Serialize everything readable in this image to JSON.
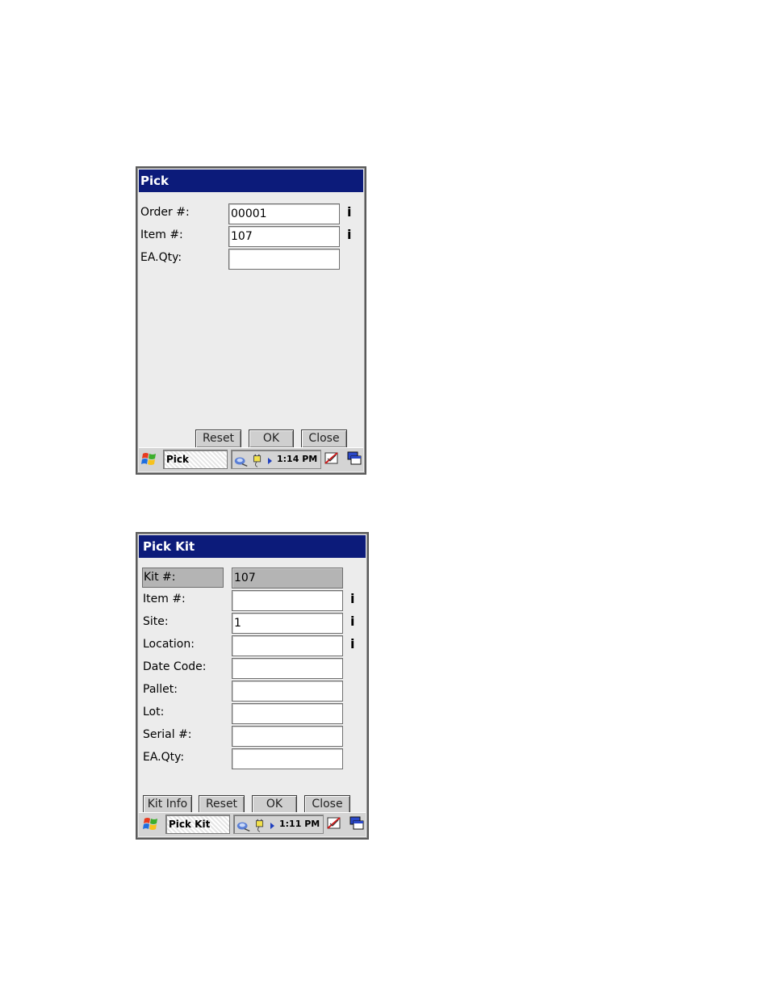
{
  "pick": {
    "title": "Pick",
    "rows": [
      {
        "label": "Order #:",
        "value": "00001",
        "info": "i"
      },
      {
        "label": "Item #:",
        "value": "107",
        "info": "i"
      },
      {
        "label": "EA.Qty:",
        "value": "",
        "info": ""
      }
    ],
    "buttons": {
      "reset": "Reset",
      "ok": "OK",
      "close": "Close"
    },
    "taskbar": {
      "task": "Pick",
      "time": "1:14 PM"
    }
  },
  "pick_kit": {
    "title": "Pick Kit",
    "kit_label": "Kit #:",
    "kit_value": "107",
    "rows": [
      {
        "label": "Item #:",
        "value": "",
        "info": "i"
      },
      {
        "label": "Site:",
        "value": "1",
        "info": "i"
      },
      {
        "label": "Location:",
        "value": "",
        "info": "i"
      },
      {
        "label": "Date Code:",
        "value": "",
        "info": ""
      },
      {
        "label": "Pallet:",
        "value": "",
        "info": ""
      },
      {
        "label": "Lot:",
        "value": "",
        "info": ""
      },
      {
        "label": "Serial #:",
        "value": "",
        "info": ""
      },
      {
        "label": "EA.Qty:",
        "value": "",
        "info": ""
      }
    ],
    "buttons": {
      "kit_info": "Kit Info",
      "reset": "Reset",
      "ok": "OK",
      "close": "Close"
    },
    "taskbar": {
      "task": "Pick Kit",
      "time": "1:11 PM"
    }
  },
  "icons": {
    "start": "windows-start-icon",
    "network": "network-icon",
    "power": "power-plug-icon",
    "arrow": "tray-arrow-icon",
    "input_panel": "input-panel-icon",
    "desktop": "desktop-icon"
  },
  "colors": {
    "titlebar": "#0c1b7a",
    "form_bg": "#ececec",
    "disabled_field": "#b4b4b4"
  }
}
